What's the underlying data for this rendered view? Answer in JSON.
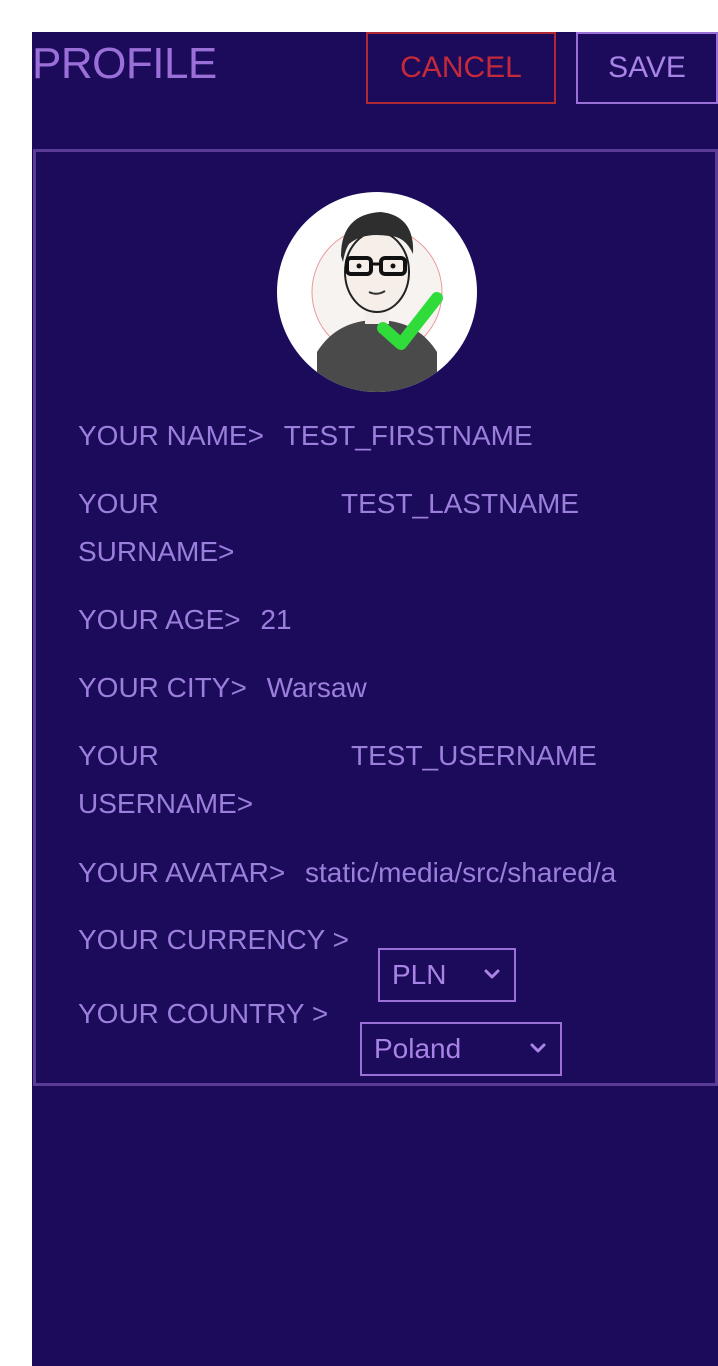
{
  "header": {
    "title": "PROFILE",
    "cancel_label": "CANCEL",
    "save_label": "SAVE"
  },
  "profile": {
    "avatar_icon": "avatar-with-checkmark",
    "name": {
      "label": "YOUR NAME>",
      "value": "TEST_FIRSTNAME"
    },
    "surname": {
      "label": "YOUR SURNAME>",
      "value": "TEST_LASTNAME"
    },
    "age": {
      "label": "YOUR AGE>",
      "value": "21"
    },
    "city": {
      "label": "YOUR CITY>",
      "value": "Warsaw"
    },
    "username": {
      "label": "YOUR USERNAME>",
      "value": "TEST_USERNAME"
    },
    "avatar": {
      "label": "YOUR AVATAR>",
      "value": "static/media/src/shared/a"
    },
    "currency": {
      "label": "YOUR CURRENCY >",
      "value": "PLN"
    },
    "country": {
      "label": "YOUR COUNTRY >",
      "value": "Poland"
    }
  },
  "colors": {
    "background": "#1c0a5a",
    "accent": "#9b6fd8",
    "cancel": "#c62a3a",
    "check": "#2fdc3a"
  }
}
